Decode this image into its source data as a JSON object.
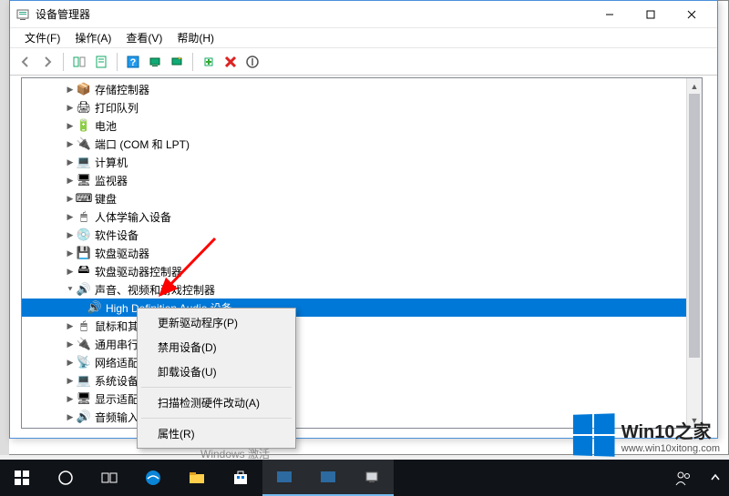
{
  "window": {
    "title": "设备管理器"
  },
  "menu": {
    "file": "文件(F)",
    "action": "操作(A)",
    "view": "查看(V)",
    "help": "帮助(H)"
  },
  "tree": {
    "items": [
      {
        "label": "存储控制器",
        "icon": "📦"
      },
      {
        "label": "打印队列",
        "icon": "🖨"
      },
      {
        "label": "电池",
        "icon": "🔋"
      },
      {
        "label": "端口 (COM 和 LPT)",
        "icon": "🔌"
      },
      {
        "label": "计算机",
        "icon": "💻"
      },
      {
        "label": "监视器",
        "icon": "🖥"
      },
      {
        "label": "键盘",
        "icon": "⌨"
      },
      {
        "label": "人体学输入设备",
        "icon": "🖱"
      },
      {
        "label": "软件设备",
        "icon": "💿"
      },
      {
        "label": "软盘驱动器",
        "icon": "💾"
      },
      {
        "label": "软盘驱动器控制器",
        "icon": "🖴"
      }
    ],
    "sound": {
      "label": "声音、视频和游戏控制器",
      "device": "High Definition Audio 设备"
    },
    "after": [
      {
        "label": "鼠标和其他",
        "icon": "🖱"
      },
      {
        "label": "通用串行",
        "icon": "🔌"
      },
      {
        "label": "网络适配",
        "icon": "📡"
      },
      {
        "label": "系统设备",
        "icon": "💻"
      },
      {
        "label": "显示适配",
        "icon": "🖥"
      },
      {
        "label": "音频输入",
        "icon": "🔊"
      }
    ]
  },
  "context": {
    "update": "更新驱动程序(P)",
    "disable": "禁用设备(D)",
    "uninstall": "卸载设备(U)",
    "scan": "扫描检测硬件改动(A)",
    "props": "属性(R)"
  },
  "footer": {
    "activate": "Windows 激活"
  },
  "watermark": {
    "title": "Win10之家",
    "url": "www.win10xitong.com"
  }
}
